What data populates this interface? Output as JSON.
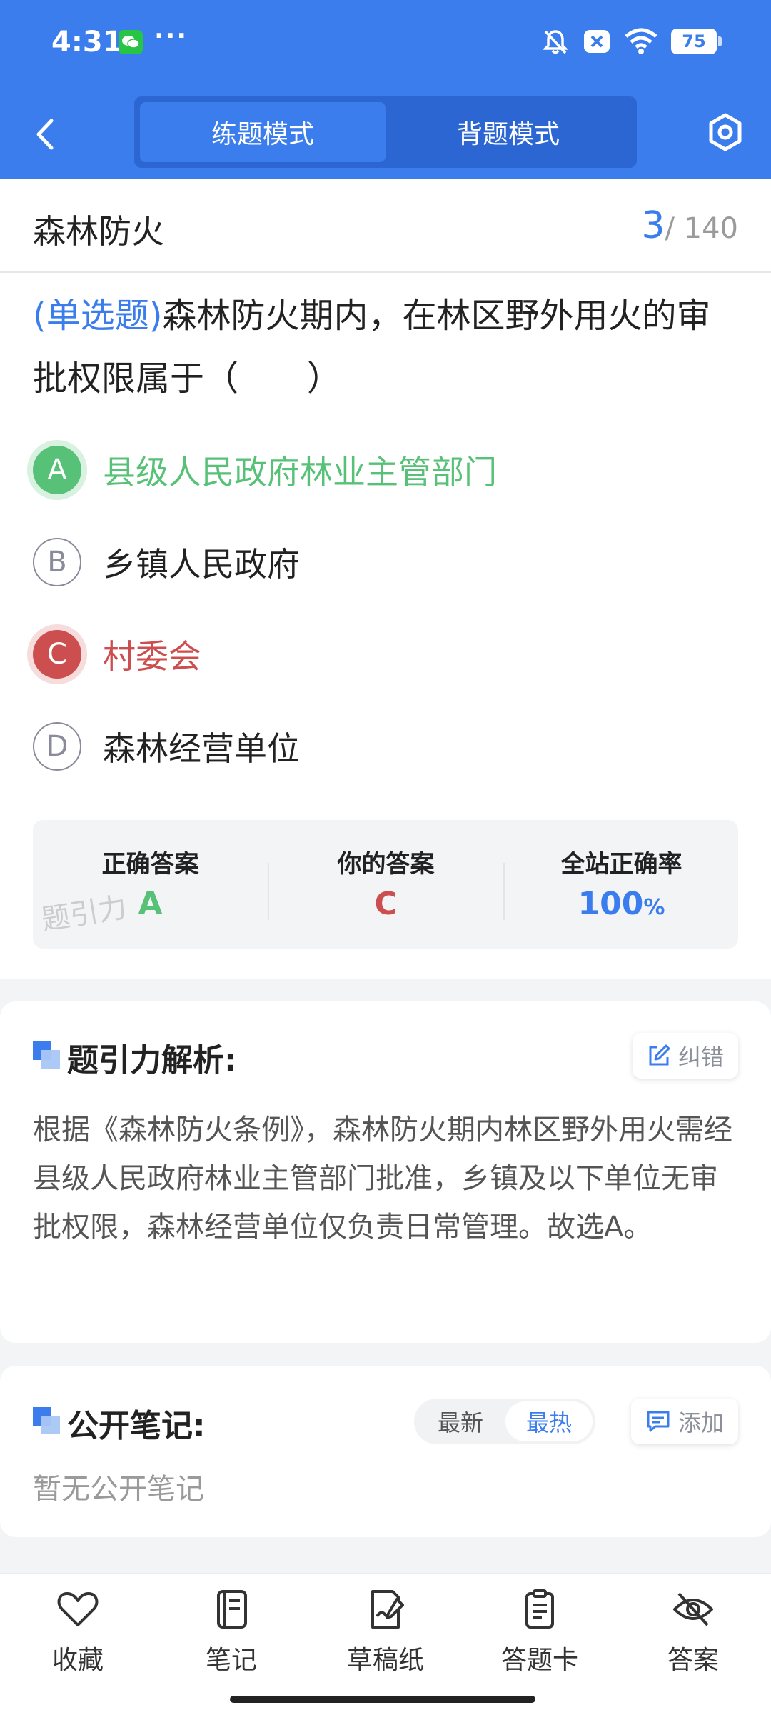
{
  "status_bar": {
    "time": "4:31",
    "more": "···",
    "battery": "75"
  },
  "nav": {
    "tabs": [
      "练题模式",
      "背题模式"
    ],
    "active_tab": "练题模式"
  },
  "section": {
    "title": "森林防火",
    "current": "3",
    "total": "/ 140"
  },
  "question": {
    "type": "(单选题)",
    "text": "森林防火期内，在林区野外用火的审批权限属于（　　）"
  },
  "options": [
    {
      "letter": "A",
      "text": "县级人民政府林业主管部门",
      "state": "correct"
    },
    {
      "letter": "B",
      "text": "乡镇人民政府",
      "state": "normal"
    },
    {
      "letter": "C",
      "text": "村委会",
      "state": "wrong"
    },
    {
      "letter": "D",
      "text": "森林经营单位",
      "state": "normal"
    }
  ],
  "result": {
    "correct_label": "正确答案",
    "correct_value": "A",
    "yours_label": "你的答案",
    "yours_value": "C",
    "rate_label": "全站正确率",
    "rate_value": "100",
    "rate_unit": "%",
    "watermark": "题引力"
  },
  "analysis": {
    "title": "题引力解析:",
    "report_label": "纠错",
    "text": "根据《森林防火条例》，森林防火期内林区野外用火需经县级人民政府林业主管部门批准，乡镇及以下单位无审批权限，森林经营单位仅负责日常管理。故选A。"
  },
  "notes": {
    "title": "公开笔记:",
    "sort_options": [
      "最新",
      "最热"
    ],
    "active_sort": "最热",
    "add_label": "添加",
    "empty_text": "暂无公开笔记"
  },
  "toolbar": [
    {
      "label": "收藏",
      "icon": "heart-icon"
    },
    {
      "label": "笔记",
      "icon": "notebook-icon"
    },
    {
      "label": "草稿纸",
      "icon": "draft-paper-icon"
    },
    {
      "label": "答题卡",
      "icon": "answer-card-icon"
    },
    {
      "label": "答案",
      "icon": "eye-off-icon"
    }
  ],
  "colors": {
    "primary": "#3b7ded",
    "correct": "#58c178",
    "wrong": "#cc4e4e",
    "background": "#f3f4f6"
  }
}
